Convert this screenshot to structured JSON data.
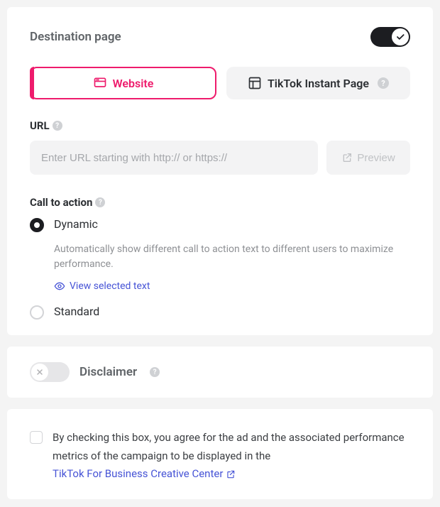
{
  "destination": {
    "title": "Destination page",
    "toggle_on": true,
    "tabs": {
      "website": {
        "label": "Website",
        "selected": true
      },
      "instant": {
        "label": "TikTok Instant Page",
        "selected": false
      }
    },
    "url": {
      "label": "URL",
      "placeholder": "Enter URL starting with http:// or https://",
      "value": "",
      "preview_label": "Preview"
    },
    "cta": {
      "label": "Call to action",
      "dynamic": {
        "label": "Dynamic",
        "selected": true,
        "description": "Automatically show different call to action text to different users to maximize performance.",
        "view_link": "View selected text"
      },
      "standard": {
        "label": "Standard",
        "selected": false
      }
    }
  },
  "disclaimer": {
    "title": "Disclaimer",
    "toggle_on": false
  },
  "agreement": {
    "checked": false,
    "text_before": "By checking this box, you agree for the ad and the associated performance metrics of the campaign to be displayed in the ",
    "link_text": "TikTok For Business Creative Center"
  }
}
